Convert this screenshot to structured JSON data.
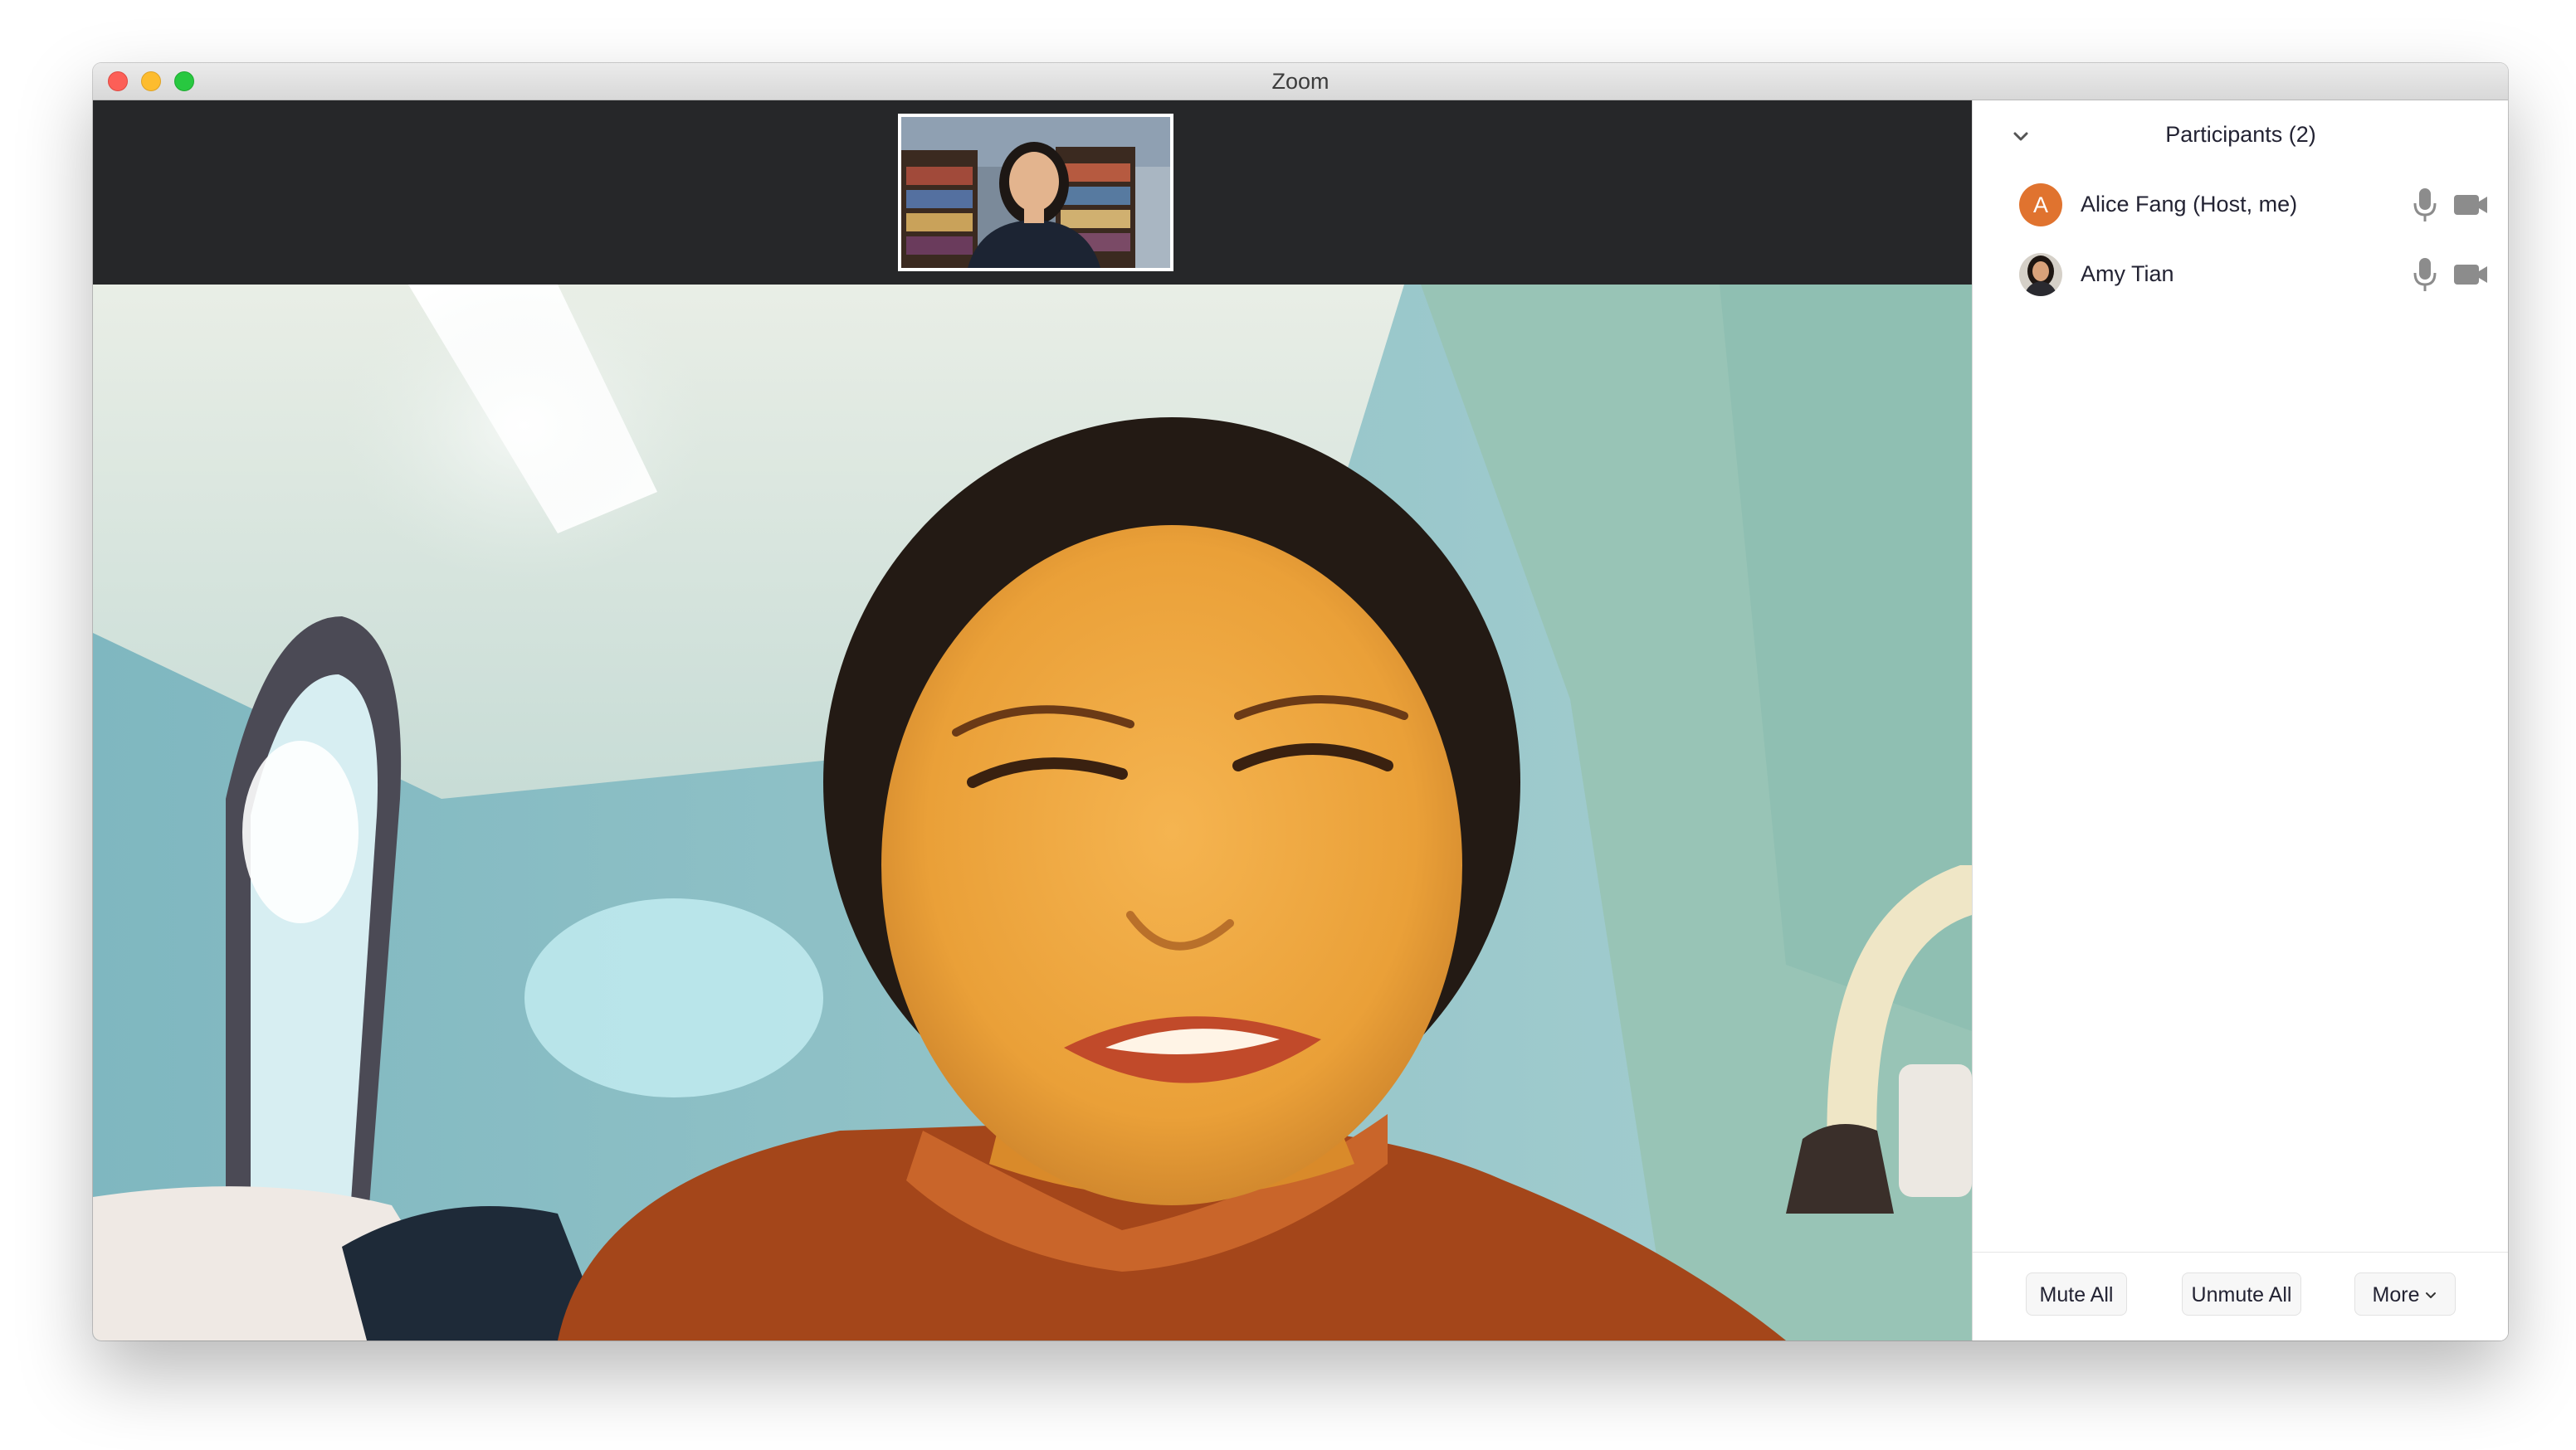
{
  "window": {
    "title": "Zoom"
  },
  "participants_panel": {
    "title": "Participants (2)",
    "participants": [
      {
        "name": "Alice Fang (Host, me)",
        "avatar_letter": "A",
        "avatar_color": "#e0732f"
      },
      {
        "name": "Amy Tian"
      }
    ],
    "buttons": {
      "mute_all": "Mute All",
      "unmute_all": "Unmute All",
      "more": "More"
    }
  },
  "colors": {
    "video_background": "#262729",
    "avatar_orange": "#e0732f",
    "icon_gray": "#8c8c8c"
  },
  "icons": {
    "collapse": "chevron-down-icon",
    "mic": "microphone-icon",
    "camera": "video-camera-icon",
    "more": "chevron-down-icon"
  }
}
